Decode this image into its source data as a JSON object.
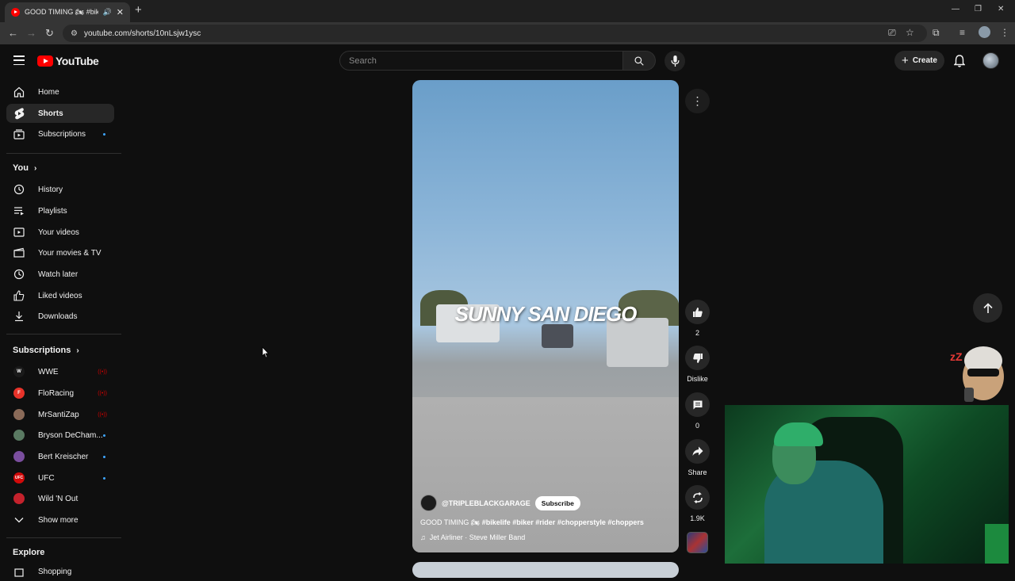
{
  "browser": {
    "tab_title": "GOOD TIMING 🏍 #bikelife",
    "url": "youtube.com/shorts/10nLsjw1ysc"
  },
  "header": {
    "logo_text": "YouTube",
    "search_placeholder": "Search",
    "create_label": "Create"
  },
  "sidebar": {
    "main_items": [
      {
        "label": "Home",
        "icon": "home-icon"
      },
      {
        "label": "Shorts",
        "icon": "shorts-icon"
      },
      {
        "label": "Subscriptions",
        "icon": "subscriptions-icon"
      }
    ],
    "you_heading": "You",
    "you_items": [
      {
        "label": "History",
        "icon": "history-icon"
      },
      {
        "label": "Playlists",
        "icon": "playlists-icon"
      },
      {
        "label": "Your videos",
        "icon": "your-videos-icon"
      },
      {
        "label": "Your movies & TV",
        "icon": "movies-icon"
      },
      {
        "label": "Watch later",
        "icon": "watch-later-icon"
      },
      {
        "label": "Liked videos",
        "icon": "like-icon"
      },
      {
        "label": "Downloads",
        "icon": "download-icon"
      }
    ],
    "subscriptions_heading": "Subscriptions",
    "channels": [
      {
        "label": "WWE",
        "color": "#1a1a1a",
        "status": "live"
      },
      {
        "label": "FloRacing",
        "color": "#e8332a",
        "status": "live"
      },
      {
        "label": "MrSantiZap",
        "color": "#8a6a58",
        "status": "live"
      },
      {
        "label": "Bryson DeCham...",
        "color": "#5a7a62",
        "status": "new"
      },
      {
        "label": "Bert Kreischer",
        "color": "#7a4e9e",
        "status": "new"
      },
      {
        "label": "UFC",
        "color": "#d20a0a",
        "status": "new"
      },
      {
        "label": "Wild 'N Out",
        "color": "#c4222c",
        "status": ""
      }
    ],
    "show_more": "Show more",
    "explore_heading": "Explore",
    "explore_partial": "Shopping"
  },
  "short": {
    "overlay_text": "SUNNY SAN DIEGO",
    "channel": "@TRIPLEBLACKGARAGE",
    "subscribe_label": "Subscribe",
    "title_plain": "GOOD TIMING 🏍 ",
    "title_tags": "#bikelife #biker #rider #chopperstyle #choppers",
    "music": "Jet Airliner · Steve Miller Band"
  },
  "actions": {
    "likes": "2",
    "dislike_label": "Dislike",
    "comments": "0",
    "share_label": "Share",
    "remix_count": "1.9K"
  },
  "colors": {
    "accent_red": "#ff0000",
    "new_dot": "#3ea6ff",
    "bg": "#0f0f0f"
  }
}
